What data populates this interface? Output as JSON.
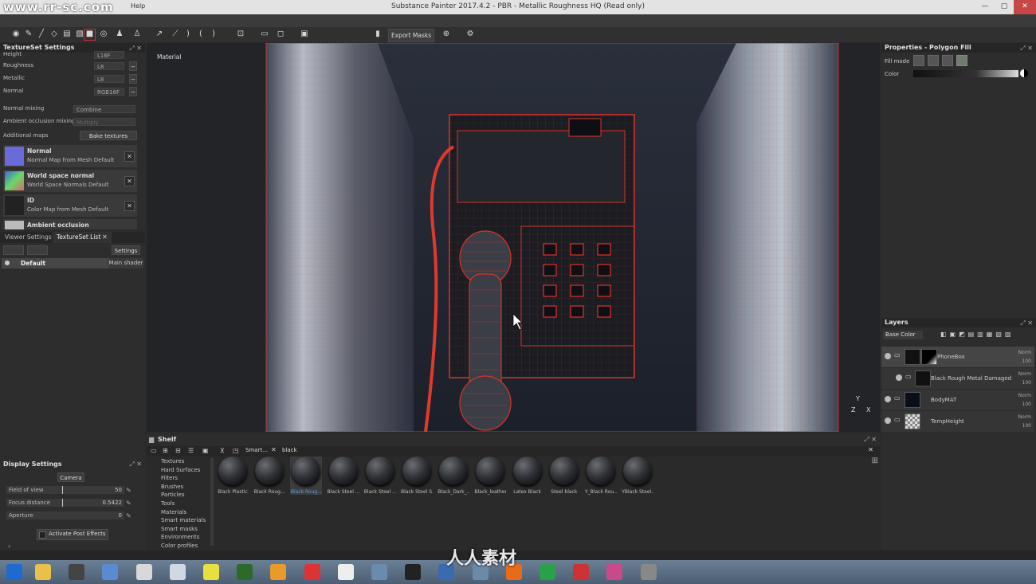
{
  "window": {
    "title": "Substance Painter 2017.4.2 - PBR - Metallic Roughness HQ (Read only)",
    "watermark": "www.rr-sc.com",
    "help_menu": "Help"
  },
  "toolbar": {
    "export_label": "Export Masks"
  },
  "textureset_settings": {
    "title": "TextureSet Settings",
    "channels": [
      {
        "name": "Height",
        "format": "L16F"
      },
      {
        "name": "Roughness",
        "format": "L8"
      },
      {
        "name": "Metallic",
        "format": "L8"
      },
      {
        "name": "Normal",
        "format": "RGB16F"
      }
    ],
    "normal_mixing_label": "Normal mixing",
    "normal_mixing_value": "Combine",
    "ao_mixing_label": "Ambient occlusion mixing",
    "ao_mixing_value": "Multiply",
    "additional_maps_label": "Additional maps",
    "bake_button": "Bake textures",
    "maps": [
      {
        "name": "Normal",
        "sub": "Normal Map from Mesh Default",
        "color": "#6a6ad8"
      },
      {
        "name": "World space normal",
        "sub": "World Space Normals Default",
        "color": "#5a9a6a"
      },
      {
        "name": "ID",
        "sub": "Color Map from Mesh Default",
        "color": "#222222"
      },
      {
        "name": "Ambient occlusion",
        "sub": "",
        "color": "#bbbbbb"
      }
    ]
  },
  "tabs": {
    "viewer_settings": "Viewer Settings",
    "textureset_list": "TextureSet List",
    "close": "✕"
  },
  "textureset_list": {
    "settings_button": "Settings",
    "item_name": "Default",
    "item_shader": "Main shader"
  },
  "display_settings": {
    "title": "Display Settings",
    "camera_button": "Camera",
    "fields": [
      {
        "label": "Field of view",
        "value": "50"
      },
      {
        "label": "Focus distance",
        "value": "0.5422"
      },
      {
        "label": "Aperture",
        "value": "0"
      }
    ],
    "post_effects": "Activate Post Effects"
  },
  "viewport": {
    "mode_label": "Material",
    "axis_y": "Y",
    "axis_z": "Z",
    "axis_x": "X"
  },
  "shelf": {
    "title": "Shelf",
    "tab_label": "Smart...",
    "search_value": "black",
    "categories": [
      "Textures",
      "Hard Surfaces",
      "Filters",
      "Brushes",
      "Particles",
      "Tools",
      "Materials",
      "Smart materials",
      "Smart masks",
      "Environments",
      "Color profiles"
    ],
    "materials": [
      "Black Plastic",
      "Black Roug...",
      "Black Roug...",
      "Black Steel ...",
      "Black Steel ...",
      "Black Steel S...",
      "Black_Dark_...",
      "Black_leather",
      "Latex Black",
      "Steel black",
      "Y_Black Rou...",
      "YBlack Steel..."
    ],
    "selected_index": 2
  },
  "properties": {
    "title": "Properties - Polygon Fill",
    "fill_mode_label": "Fill mode",
    "color_label": "Color"
  },
  "layers": {
    "title": "Layers",
    "channel_select": "Base Color",
    "items": [
      {
        "name": "PhoneBox",
        "blend": "Norm",
        "opacity": "100"
      },
      {
        "name": "Black Rough Metal Damaged",
        "blend": "Norm",
        "opacity": "100"
      },
      {
        "name": "BodyMAT",
        "blend": "Norm",
        "opacity": "100"
      },
      {
        "name": "TempHeight",
        "blend": "Norm",
        "opacity": "100"
      }
    ]
  },
  "taskbar": {
    "icons": [
      "start-icon",
      "file-explorer-icon",
      "paint-icon",
      "notepad-icon",
      "paint-app-icon",
      "window-icon",
      "pencil-icon",
      "terminal-icon",
      "butterfly-icon",
      "x-app-icon",
      "document-icon",
      "palette-icon",
      "app-icon",
      "camera-icon",
      "window-app-icon",
      "firefox-icon",
      "chrome-icon",
      "substance-icon",
      "browser-icon",
      "shield-icon"
    ],
    "brand_text": "人人素材"
  }
}
